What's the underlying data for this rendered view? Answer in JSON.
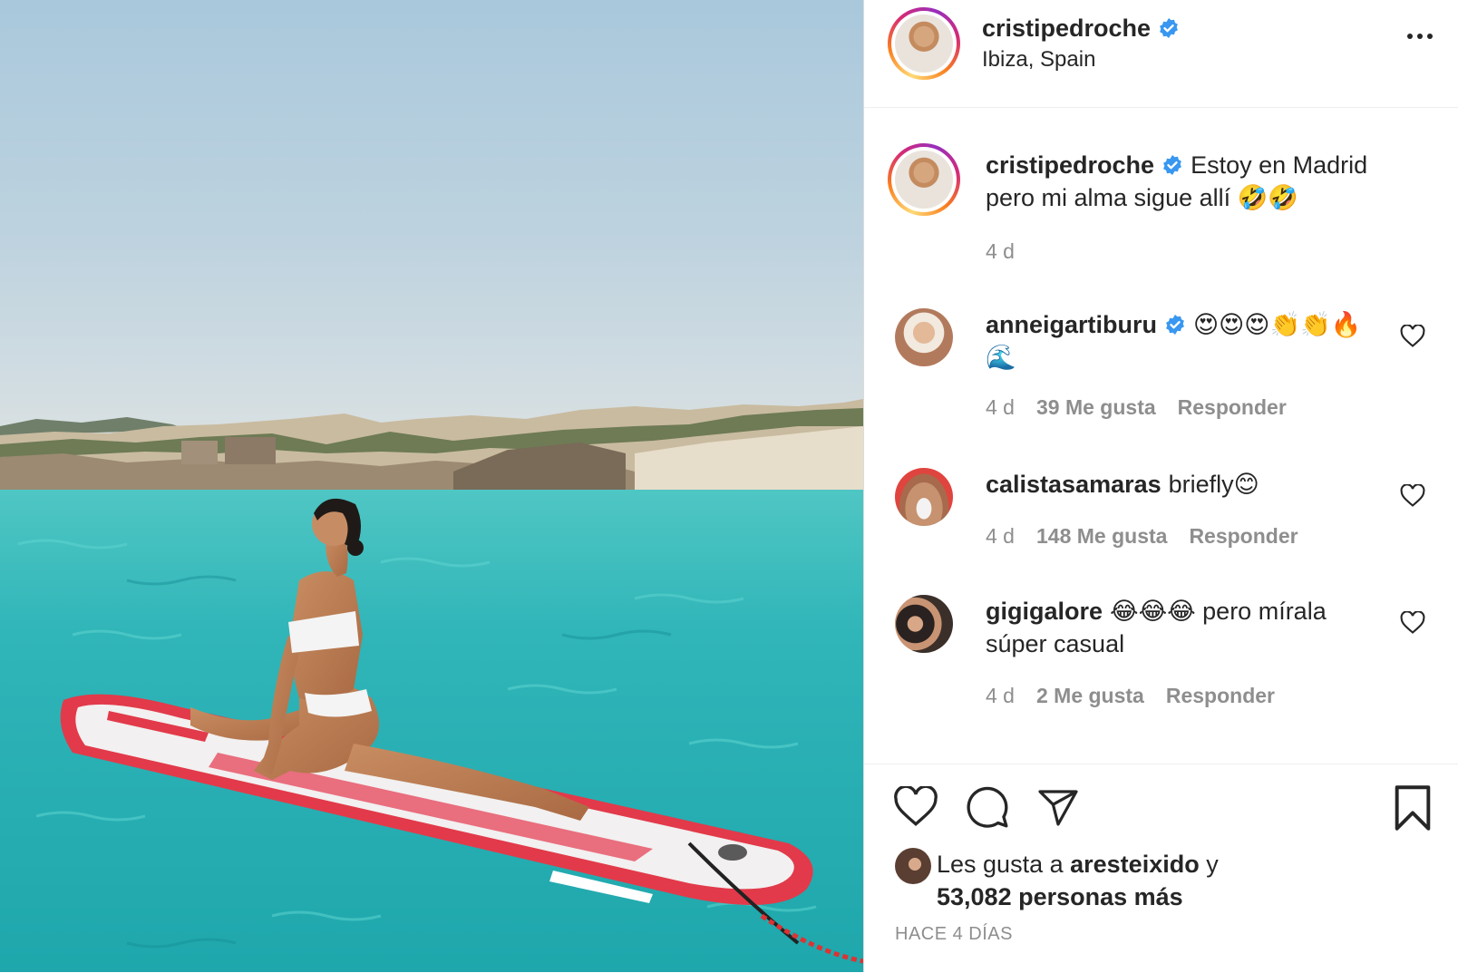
{
  "post": {
    "author": "cristipedroche",
    "location": "Ibiza, Spain"
  },
  "caption": {
    "author": "cristipedroche",
    "text_line1": "Estoy en Madrid",
    "text_line2": "pero mi alma sigue allí 🤣🤣",
    "time": "4 d"
  },
  "comments": [
    {
      "user": "anneigartiburu",
      "verified": true,
      "text_line1": "😍😍😍👏👏🔥",
      "text_line2": "🌊",
      "time": "4 d",
      "likes": "39 Me gusta",
      "reply": "Responder"
    },
    {
      "user": "calistasamaras",
      "verified": false,
      "text_line1": "briefly😊",
      "text_line2": "",
      "time": "4 d",
      "likes": "148 Me gusta",
      "reply": "Responder"
    },
    {
      "user": "gigigalore",
      "verified": false,
      "text_line1": "😂😂😂 pero mírala",
      "text_line2": "súper casual",
      "time": "4 d",
      "likes": "2 Me gusta",
      "reply": "Responder"
    }
  ],
  "likes_summary": {
    "prefix": "Les gusta a",
    "friend": "aresteixido",
    "joiner": "y",
    "count_text": "53,082 personas más"
  },
  "timestamp": "HACE 4 DÍAS",
  "colors": {
    "verified": "#3897f0",
    "muted": "#8e8e8e",
    "text": "#262626",
    "water": "#29b8b8",
    "board": "#e23a4a"
  },
  "icons": [
    "verified-badge-icon",
    "more-options-icon",
    "heart-icon",
    "comment-icon",
    "share-icon",
    "bookmark-icon"
  ]
}
